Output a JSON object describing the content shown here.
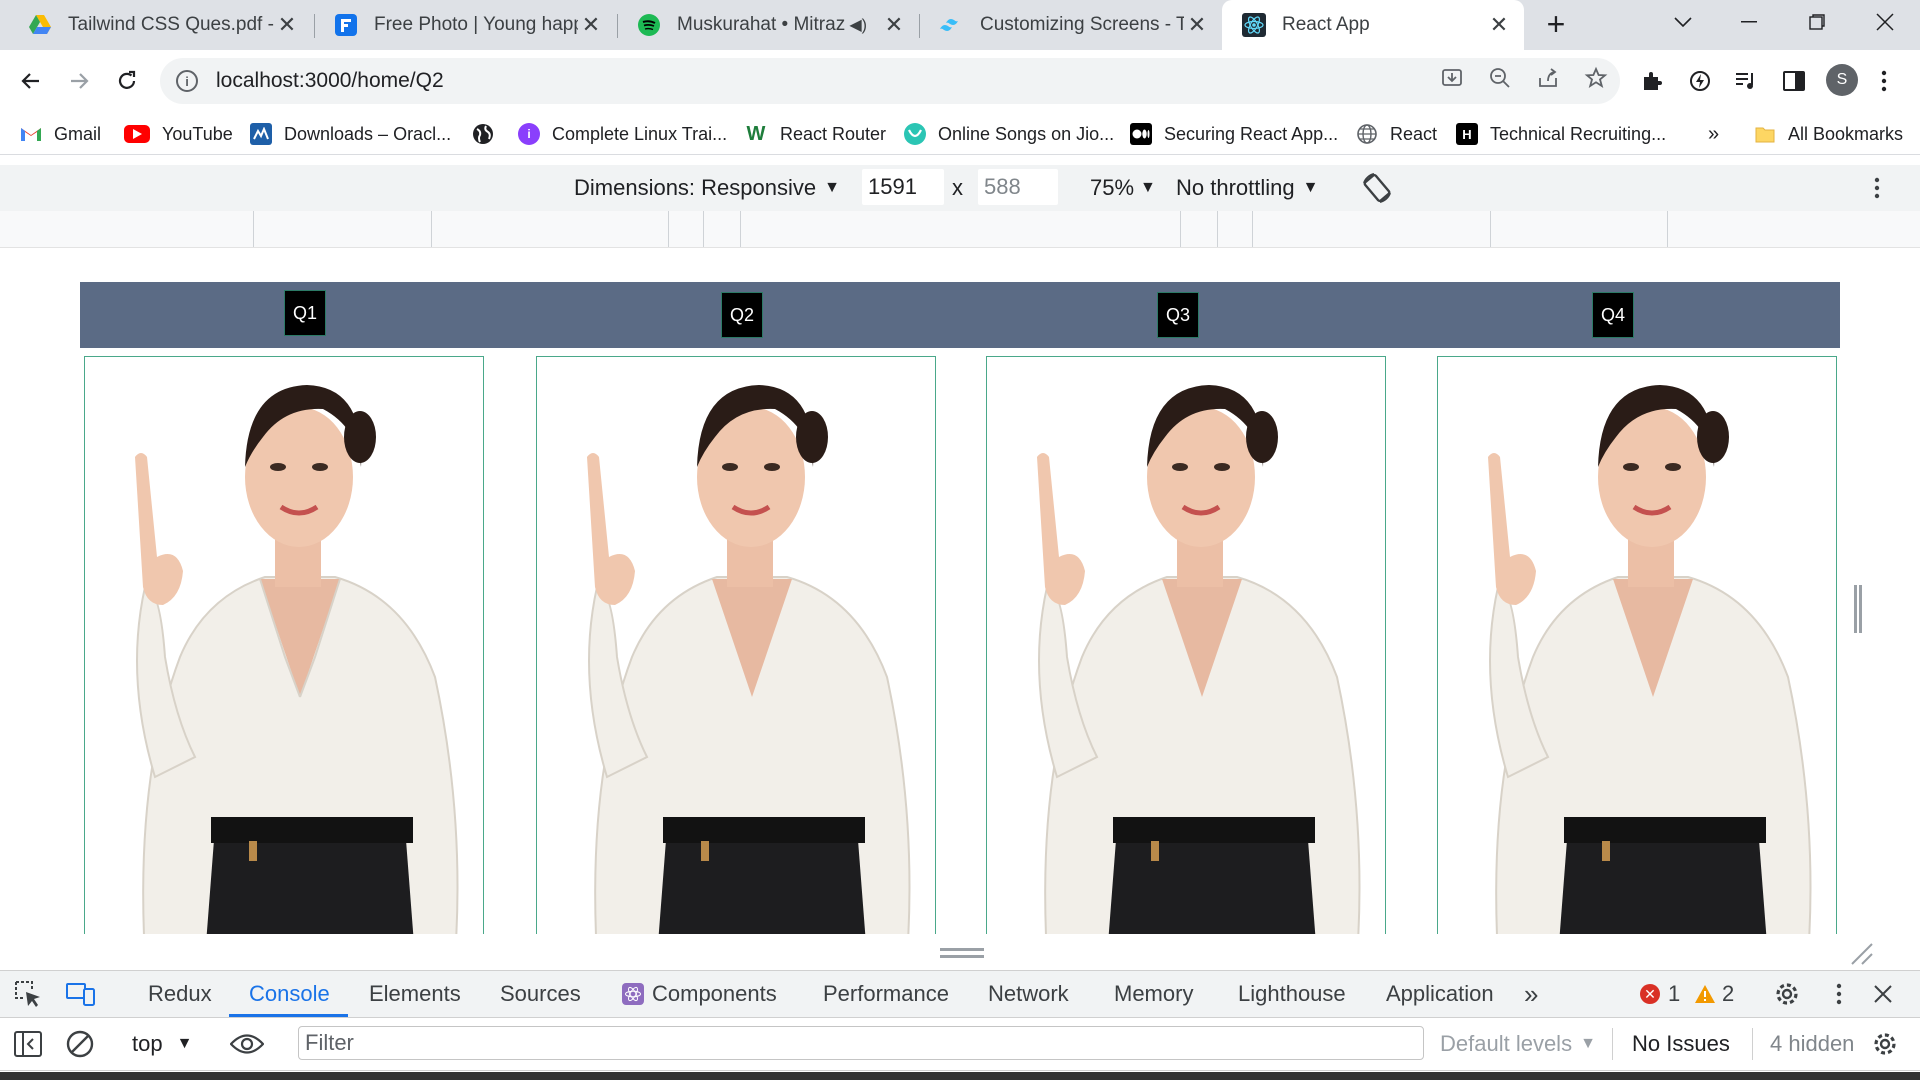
{
  "browser": {
    "tabs": [
      {
        "title": "Tailwind CSS Ques.pdf - G",
        "icon": "google-drive-icon",
        "color": "#1a73e8"
      },
      {
        "title": "Free Photo | Young happy",
        "icon": "freepik-icon",
        "color": "#1273eb"
      },
      {
        "title": "Muskurahat • Mitraz",
        "icon": "spotify-icon",
        "color": "#1db954"
      },
      {
        "title": "Customizing Screens - Tail",
        "icon": "tailwind-icon",
        "color": "#38bdf8"
      },
      {
        "title": "React App",
        "icon": "react-icon",
        "color": "#61dafb",
        "active": true
      }
    ],
    "new_tab": "+",
    "window_controls": {
      "minimize": "—",
      "maximize": "❐",
      "close": "✕",
      "search_tabs": "⌄"
    },
    "url": "localhost:3000/home/Q2",
    "profile_initial": "S"
  },
  "bookmarks": [
    {
      "label": "Gmail",
      "icon": "gmail-icon",
      "color": "#ea4335"
    },
    {
      "label": "YouTube",
      "icon": "youtube-icon",
      "color": "#ff0000"
    },
    {
      "label": "Downloads – Oracl...",
      "icon": "oracle-icon",
      "color": "#1e5fa8"
    },
    {
      "label": "",
      "icon": "globe-icon",
      "color": "#202124"
    },
    {
      "label": "Complete Linux Trai...",
      "icon": "course-icon",
      "color": "#8a3ffc"
    },
    {
      "label": "React Router",
      "icon": "react-router-icon",
      "color": "#1e7d3b"
    },
    {
      "label": "Online Songs on Jio...",
      "icon": "jiosaavn-icon",
      "color": "#2bc5b4"
    },
    {
      "label": "Securing React App...",
      "icon": "medium-icon",
      "color": "#000000"
    },
    {
      "label": "React",
      "icon": "globe-icon",
      "color": "#5f6368"
    },
    {
      "label": "Technical Recruiting...",
      "icon": "hackerrank-icon",
      "color": "#000000"
    }
  ],
  "bookmarks_more": "»",
  "all_bookmarks": "All Bookmarks",
  "device_toolbar": {
    "dimensions_label": "Dimensions: Responsive",
    "width": "1591",
    "x": "x",
    "height": "588",
    "zoom": "75%",
    "throttling": "No throttling"
  },
  "app": {
    "nav_buttons": [
      "Q1",
      "Q2",
      "Q3",
      "Q4"
    ],
    "cards": [
      {
        "image": "young-happy-woman-pointing-up-photo"
      },
      {
        "image": "young-happy-woman-pointing-up-photo"
      },
      {
        "image": "young-happy-woman-pointing-up-photo"
      },
      {
        "image": "young-happy-woman-pointing-up-photo"
      }
    ],
    "nav_color": "#5b6b85"
  },
  "devtools": {
    "tabs": [
      "Redux",
      "Console",
      "Elements",
      "Sources",
      "Components",
      "Performance",
      "Network",
      "Memory",
      "Lighthouse",
      "Application"
    ],
    "active_tab": "Console",
    "more_tabs": "»",
    "error_count": "1",
    "warning_count": "2",
    "context": "top",
    "filter_placeholder": "Filter",
    "default_levels": "Default levels",
    "issues": "No Issues",
    "hidden": "4 hidden"
  }
}
